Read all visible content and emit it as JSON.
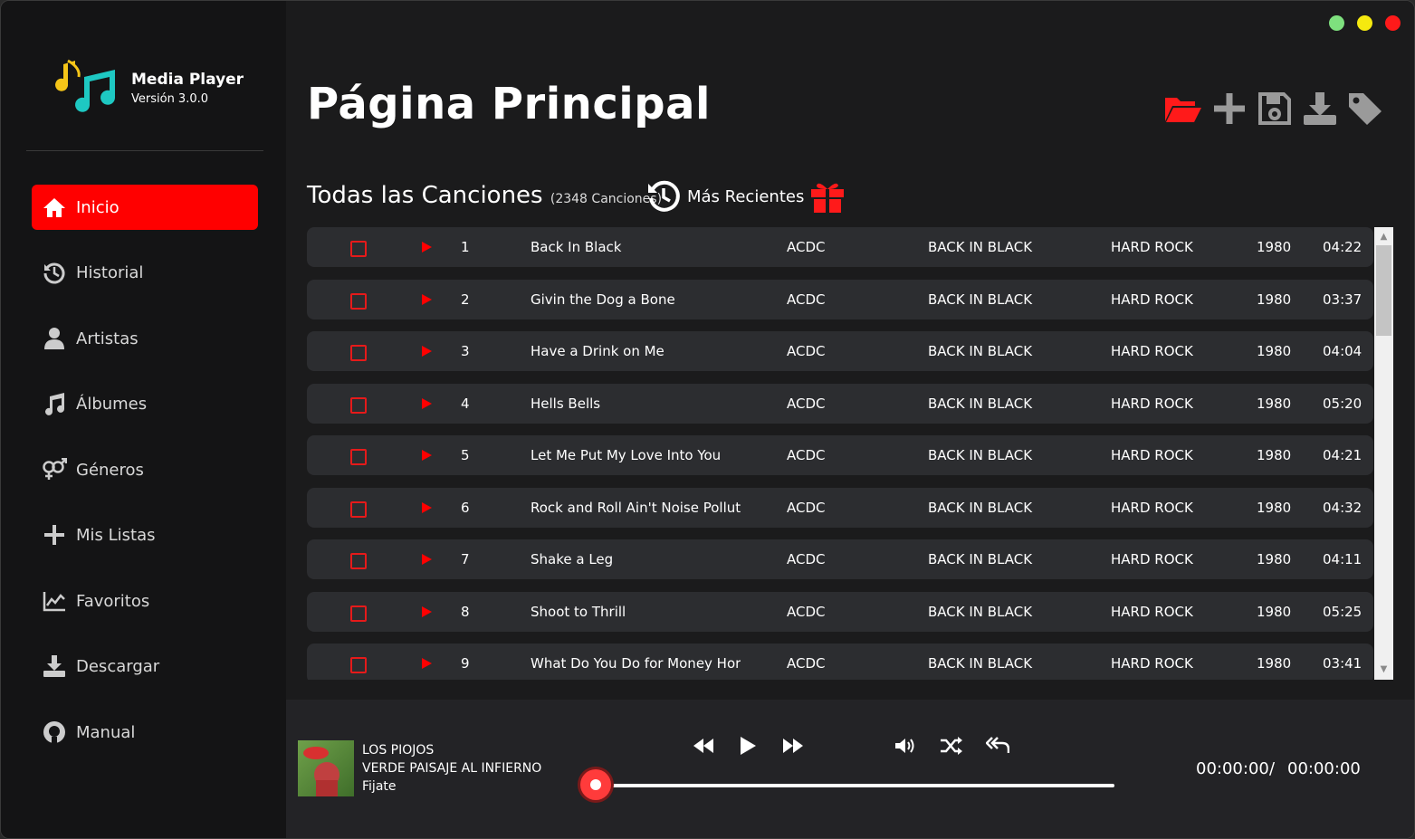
{
  "app": {
    "name": "Media Player",
    "version": "Versión 3.0.0"
  },
  "nav": [
    {
      "label": "Inicio",
      "icon": "home-icon",
      "active": true
    },
    {
      "label": "Historial",
      "icon": "history-icon"
    },
    {
      "label": "Artistas",
      "icon": "user-icon"
    },
    {
      "label": "Álbumes",
      "icon": "music-note-icon"
    },
    {
      "label": "Géneros",
      "icon": "gender-icon"
    },
    {
      "label": "Mis Listas",
      "icon": "plus-icon"
    },
    {
      "label": "Favoritos",
      "icon": "chart-icon"
    },
    {
      "label": "Descargar",
      "icon": "download-icon"
    },
    {
      "label": "Manual",
      "icon": "github-icon"
    }
  ],
  "page_title": "Página Principal",
  "toolbar": {
    "icons": [
      "folder-open-icon",
      "add-icon",
      "save-icon",
      "download-icon",
      "tag-icon"
    ],
    "accent": "#ff0000"
  },
  "section": {
    "title": "Todas las Canciones",
    "count": "(2348 Canciones)",
    "recent_label": "Más Recientes"
  },
  "songs": [
    {
      "num": "1",
      "title": "Back In Black",
      "artist": "ACDC",
      "album": "BACK IN BLACK",
      "genre": "HARD ROCK",
      "year": "1980",
      "duration": "04:22"
    },
    {
      "num": "2",
      "title": "Givin the Dog a Bone",
      "artist": "ACDC",
      "album": "BACK IN BLACK",
      "genre": "HARD ROCK",
      "year": "1980",
      "duration": "03:37"
    },
    {
      "num": "3",
      "title": "Have a Drink on Me",
      "artist": "ACDC",
      "album": "BACK IN BLACK",
      "genre": "HARD ROCK",
      "year": "1980",
      "duration": "04:04"
    },
    {
      "num": "4",
      "title": "Hells Bells",
      "artist": "ACDC",
      "album": "BACK IN BLACK",
      "genre": "HARD ROCK",
      "year": "1980",
      "duration": "05:20"
    },
    {
      "num": "5",
      "title": "Let Me Put My Love Into You",
      "artist": "ACDC",
      "album": "BACK IN BLACK",
      "genre": "HARD ROCK",
      "year": "1980",
      "duration": "04:21"
    },
    {
      "num": "6",
      "title": "Rock and Roll Ain't Noise Polluti",
      "artist": "ACDC",
      "album": "BACK IN BLACK",
      "genre": "HARD ROCK",
      "year": "1980",
      "duration": "04:32"
    },
    {
      "num": "7",
      "title": "Shake a Leg",
      "artist": "ACDC",
      "album": "BACK IN BLACK",
      "genre": "HARD ROCK",
      "year": "1980",
      "duration": "04:11"
    },
    {
      "num": "8",
      "title": "Shoot to Thrill",
      "artist": "ACDC",
      "album": "BACK IN BLACK",
      "genre": "HARD ROCK",
      "year": "1980",
      "duration": "05:25"
    },
    {
      "num": "9",
      "title": "What Do You Do for Money Hor",
      "artist": "ACDC",
      "album": "BACK IN BLACK",
      "genre": "HARD ROCK",
      "year": "1980",
      "duration": "03:41"
    }
  ],
  "now_playing": {
    "artist": "LOS PIOJOS",
    "album": "VERDE PAISAJE AL INFIERNO",
    "title": "Fijate"
  },
  "playback": {
    "current_time": "00:00:00",
    "separator": "/",
    "total_time": "00:00:00",
    "progress": 0
  },
  "traffic_lights": {
    "green": "#7ee07e",
    "yellow": "#f5e90f",
    "red": "#ff1a1a"
  }
}
